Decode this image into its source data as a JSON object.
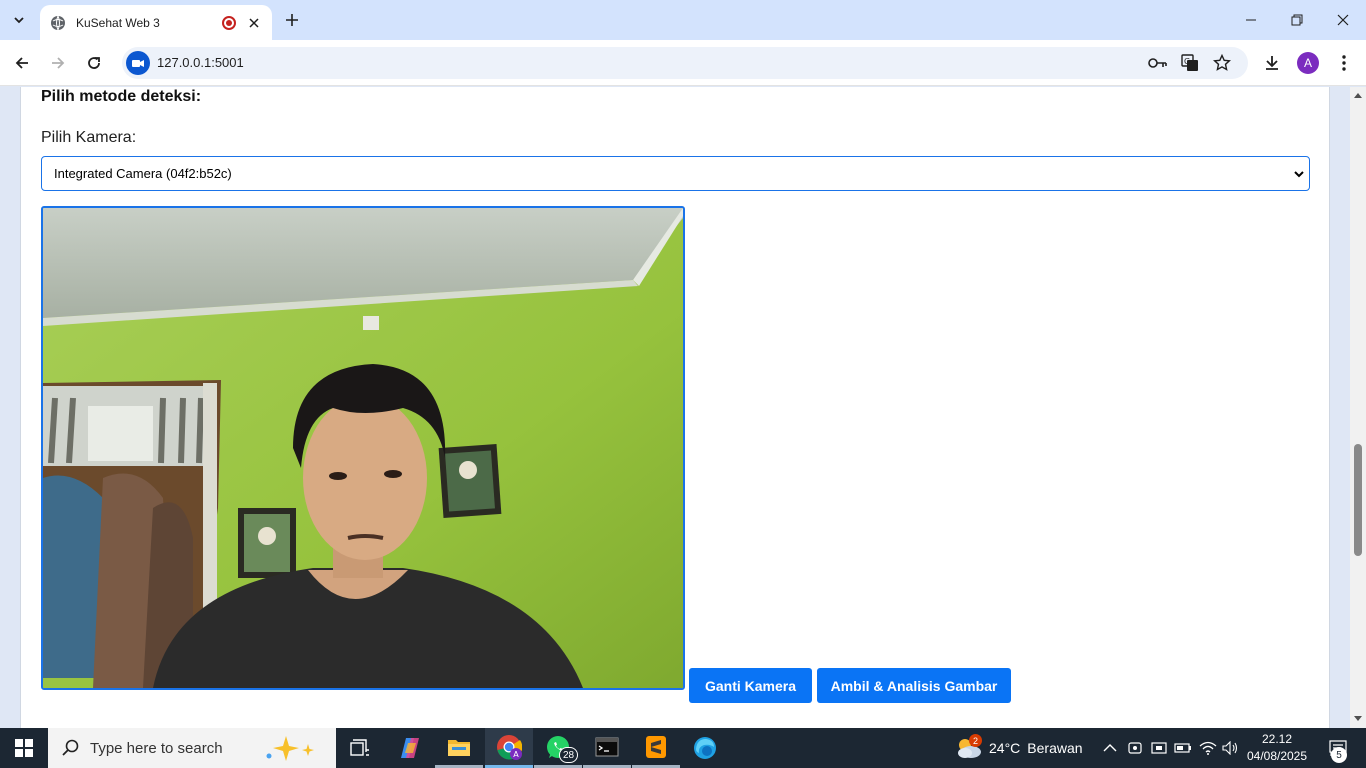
{
  "browser": {
    "tab_title": "KuSehat Web 3",
    "url": "127.0.0.1:5001",
    "profile_initial": "A"
  },
  "page": {
    "heading": "Pilih metode deteksi:",
    "camera_label": "Pilih Kamera:",
    "camera_selected": "Integrated Camera (04f2:b52c)",
    "btn_switch": "Ganti Kamera",
    "btn_capture": "Ambil & Analisis Gambar"
  },
  "taskbar": {
    "search_placeholder": "Type here to search",
    "whatsapp_badge": "28",
    "weather_badge": "2",
    "temperature": "24°C",
    "weather_text": "Berawan",
    "time": "22.12",
    "date": "04/08/2025",
    "notifications": "5"
  },
  "colors": {
    "accent": "#0a74f5",
    "tabstrip": "#d3e3fd",
    "taskbar": "#1c2733"
  }
}
